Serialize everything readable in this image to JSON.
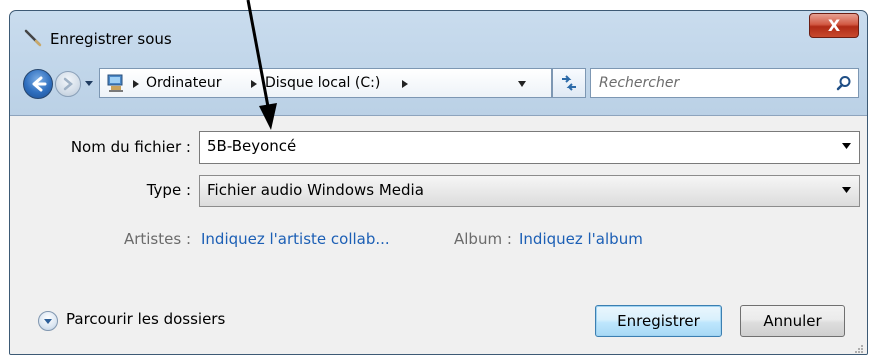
{
  "window": {
    "title": "Enregistrer sous",
    "close_label": "X"
  },
  "addressbar": {
    "crumbs": [
      "Ordinateur",
      "Disque local (C:)"
    ],
    "search_placeholder": "Rechercher"
  },
  "form": {
    "filename_label": "Nom du fichier :",
    "filename_value": "5B-Beyoncé",
    "type_label": "Type :",
    "type_value": "Fichier audio Windows Media",
    "artists_label": "Artistes :",
    "artists_link": "Indiquez l'artiste collab...",
    "album_label": "Album :",
    "album_link": "Indiquez l'album"
  },
  "footer": {
    "browse_label": "Parcourir les dossiers",
    "save_label": "Enregistrer",
    "cancel_label": "Annuler"
  },
  "colors": {
    "chrome": "#b6cde3",
    "link": "#1c5fb5",
    "close": "#c84a2e"
  }
}
